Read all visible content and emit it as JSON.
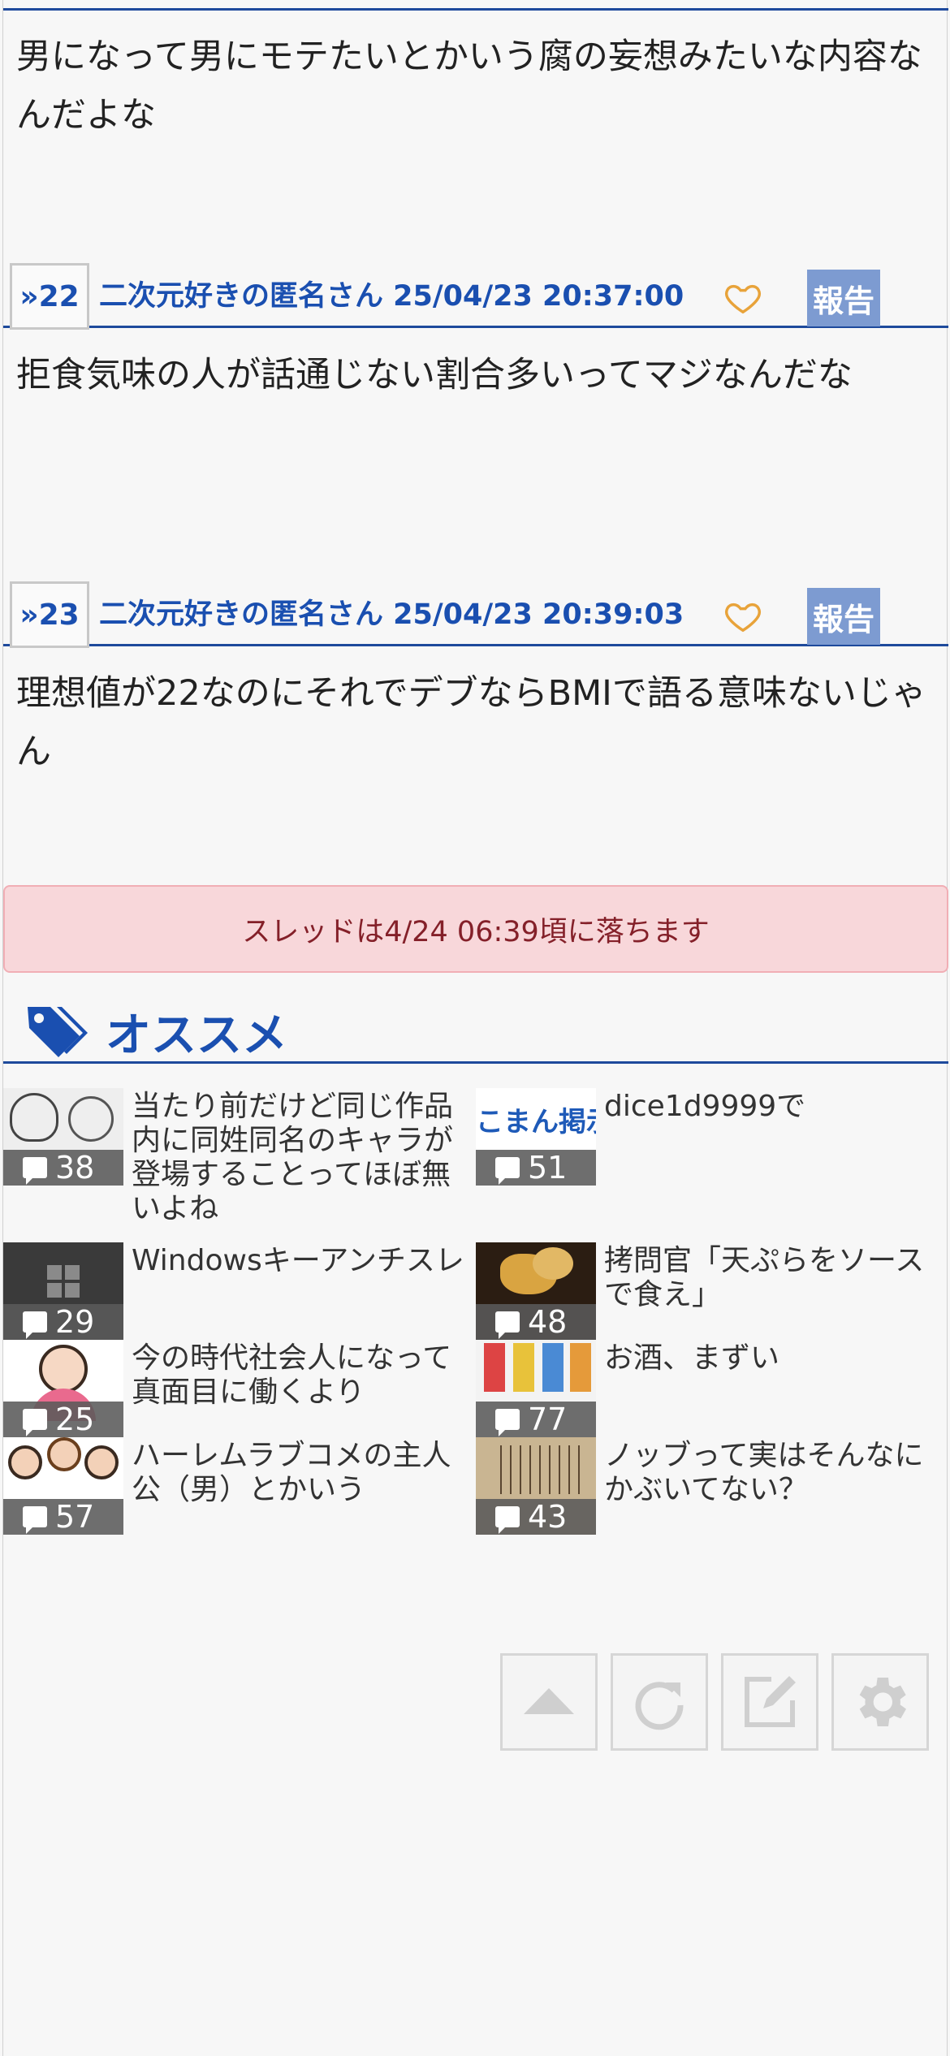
{
  "posts": [
    {
      "body": "男になって男にモテたいとかいう腐の妄想みたいな内容なんだよな"
    },
    {
      "number": "»22",
      "author_date": "二次元好きの匿名さん 25/04/23 20:37:00",
      "report": "報告",
      "body": "拒食気味の人が話通じない割合多いってマジなんだな"
    },
    {
      "number": "»23",
      "author_date": "二次元好きの匿名さん 25/04/23 20:39:03",
      "report": "報告",
      "body": "理想値が22なのにそれでデブならBMIで語る意味ないじゃん"
    }
  ],
  "notice": "スレッドは4/24 06:39頃に落ちます",
  "recommend": {
    "title": "オススメ",
    "items": [
      {
        "count": "38",
        "title": "当たり前だけど同じ作品内に同姓同名のキャラが登場することってほぼ無いよね"
      },
      {
        "count": "51",
        "title": "dice1d9999で"
      },
      {
        "count": "29",
        "title": "Windowsキーアンチスレ"
      },
      {
        "count": "48",
        "title": "拷問官「天ぷらをソースで食え」"
      },
      {
        "count": "25",
        "title": "今の時代社会人になって真面目に働くより"
      },
      {
        "count": "77",
        "title": "お酒、まずい"
      },
      {
        "count": "57",
        "title": "ハーレムラブコメの主人公（男）とかいう"
      },
      {
        "count": "43",
        "title": "ノッブって実はそんなにかぶいてない？"
      }
    ]
  },
  "colors": {
    "accent": "#1a4fb0",
    "report_bg": "#7d9bd1",
    "notice_bg": "#f8d7da",
    "heart": "#e8a33a"
  }
}
